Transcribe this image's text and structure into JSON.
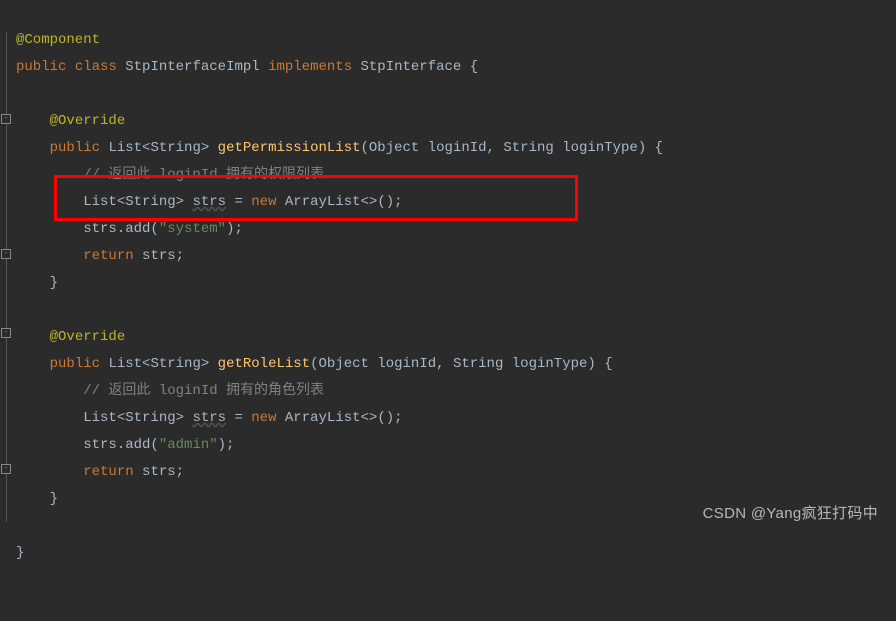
{
  "lines": {
    "l1_ann": "@Component",
    "l2_kw_public": "public",
    "l2_kw_class": "class",
    "l2_name": "StpInterfaceImpl",
    "l2_impl": "implements",
    "l2_iface": "StpInterface",
    "l4_ann": "@Override",
    "l5_kw_public": "public",
    "l5_rtype": "List<String>",
    "l5_method": "getPermissionList",
    "l5_p1t": "Object",
    "l5_p1n": "loginId",
    "l5_p2t": "String",
    "l5_p2n": "loginType",
    "l6_cmt": "// 返回此 loginId 拥有的权限列表",
    "l7_decl_t": "List<String>",
    "l7_var": "strs",
    "l7_eq": " = ",
    "l7_new": "new",
    "l7_ctor": "ArrayList<>()",
    "l8_call": "strs.add(",
    "l8_str": "\"system\"",
    "l8_end": ");",
    "l9_ret": "return",
    "l9_var": "strs",
    "l12_ann": "@Override",
    "l13_kw_public": "public",
    "l13_rtype": "List<String>",
    "l13_method": "getRoleList",
    "l13_p1t": "Object",
    "l13_p1n": "loginId",
    "l13_p2t": "String",
    "l13_p2n": "loginType",
    "l14_cmt": "// 返回此 loginId 拥有的角色列表",
    "l15_decl_t": "List<String>",
    "l15_var": "strs",
    "l15_new": "new",
    "l15_ctor": "ArrayList<>()",
    "l16_call": "strs.add(",
    "l16_str": "\"admin\"",
    "l16_end": ");",
    "l17_ret": "return",
    "l17_var": "strs"
  },
  "watermark": "CSDN @Yang疯狂打码中"
}
